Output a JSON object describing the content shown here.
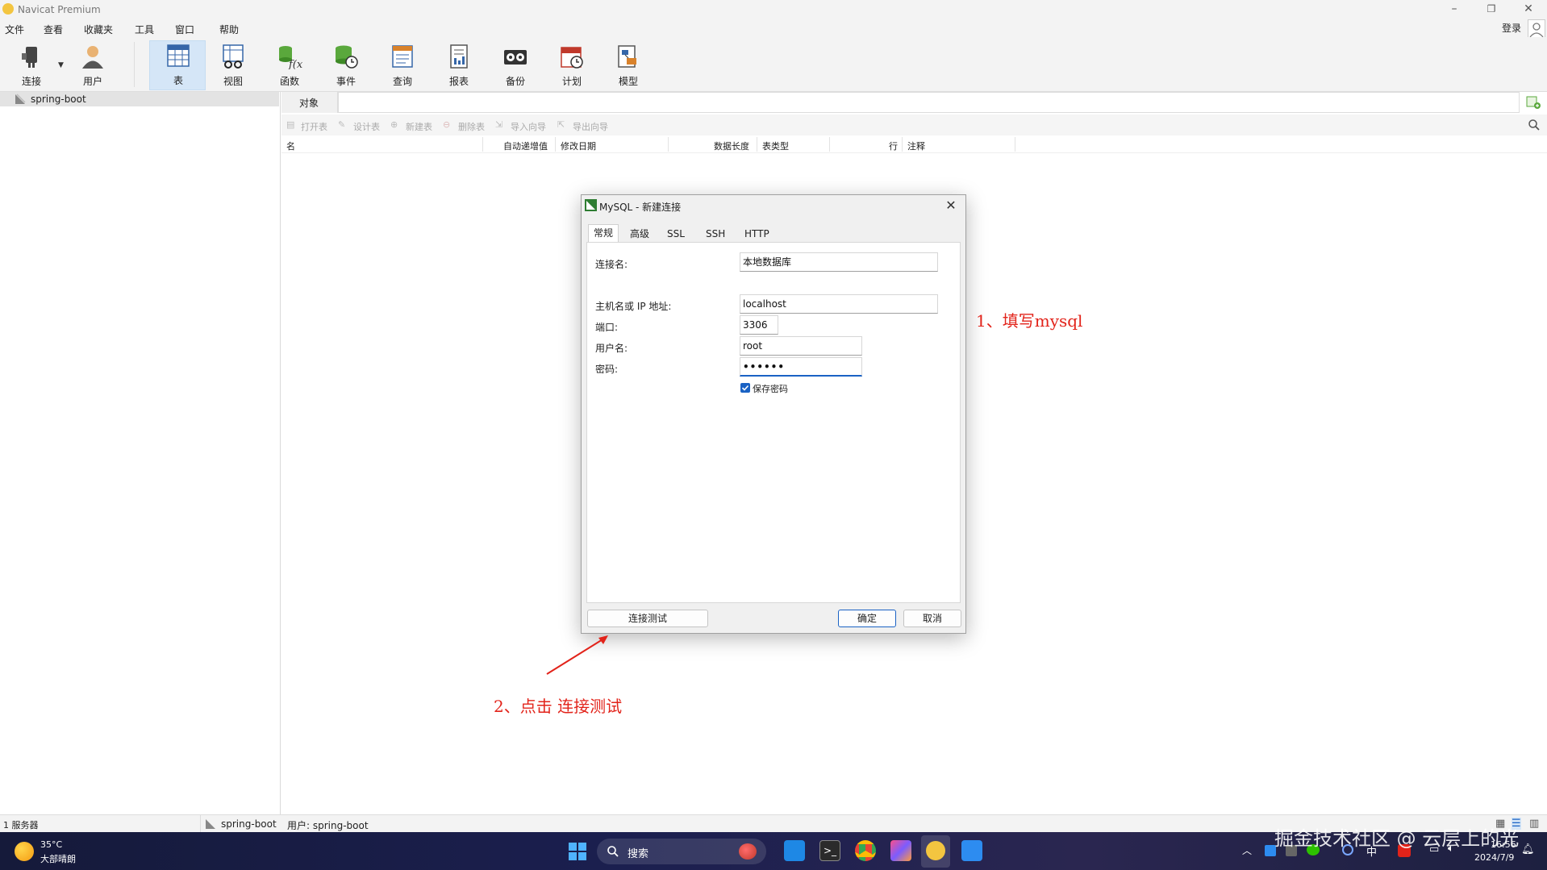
{
  "window": {
    "title": "Navicat Premium"
  },
  "menu": [
    "文件",
    "查看",
    "收藏夹",
    "工具",
    "窗口",
    "帮助"
  ],
  "account": {
    "login_label": "登录"
  },
  "toolbar": [
    {
      "label": "连接",
      "icon": "connection-plug-icon"
    },
    {
      "label": "用户",
      "icon": "user-icon"
    },
    {
      "label": "表",
      "icon": "table-icon"
    },
    {
      "label": "视图",
      "icon": "view-glasses-icon"
    },
    {
      "label": "函数",
      "icon": "function-fx-icon"
    },
    {
      "label": "事件",
      "icon": "event-clock-icon"
    },
    {
      "label": "查询",
      "icon": "query-icon"
    },
    {
      "label": "报表",
      "icon": "report-icon"
    },
    {
      "label": "备份",
      "icon": "backup-icon"
    },
    {
      "label": "计划",
      "icon": "schedule-calendar-icon"
    },
    {
      "label": "模型",
      "icon": "model-icon"
    }
  ],
  "sidebar": {
    "connection": "spring-boot"
  },
  "object_tab": {
    "label": "对象"
  },
  "actions": [
    "打开表",
    "设计表",
    "新建表",
    "删除表",
    "导入向导",
    "导出向导"
  ],
  "columns": [
    "名",
    "自动递增值",
    "修改日期",
    "数据长度",
    "表类型",
    "行",
    "注释"
  ],
  "dialog": {
    "title": "MySQL - 新建连接",
    "tabs": [
      "常规",
      "高级",
      "SSL",
      "SSH",
      "HTTP"
    ],
    "fields": {
      "conn_name_label": "连接名:",
      "conn_name_value": "本地数据库",
      "host_label": "主机名或 IP 地址:",
      "host_value": "localhost",
      "port_label": "端口:",
      "port_value": "3306",
      "user_label": "用户名:",
      "user_value": "root",
      "password_label": "密码:",
      "password_value": "••••••",
      "save_password_label": "保存密码",
      "save_password_checked": true
    },
    "buttons": {
      "test": "连接测试",
      "ok": "确定",
      "cancel": "取消"
    }
  },
  "annotations": {
    "note1": "1、填写mysql",
    "note2": "2、点击 连接测试"
  },
  "statusbar": {
    "servers": "1 服务器",
    "connection": "spring-boot",
    "user": "用户: spring-boot"
  },
  "taskbar": {
    "weather_temp": "35°C",
    "weather_desc": "大部晴朗",
    "search_placeholder": "搜索",
    "ime": "中",
    "time": "16:56",
    "date": "2024/7/9"
  },
  "watermark": "掘金技术社区 @ 云层上的光",
  "colors": {
    "accent": "#1a62c4",
    "annotation": "#e2231a",
    "selected_tool": "#d5e6f7"
  }
}
